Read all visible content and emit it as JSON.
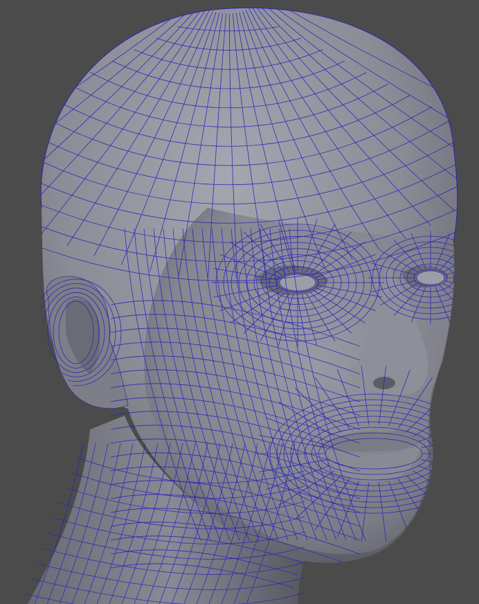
{
  "viewport": {
    "background_color": "#4b4b4b",
    "mesh_color": "#2a23b8",
    "surface_color": "#8a8a96",
    "subject": "head-wireframe-render"
  }
}
